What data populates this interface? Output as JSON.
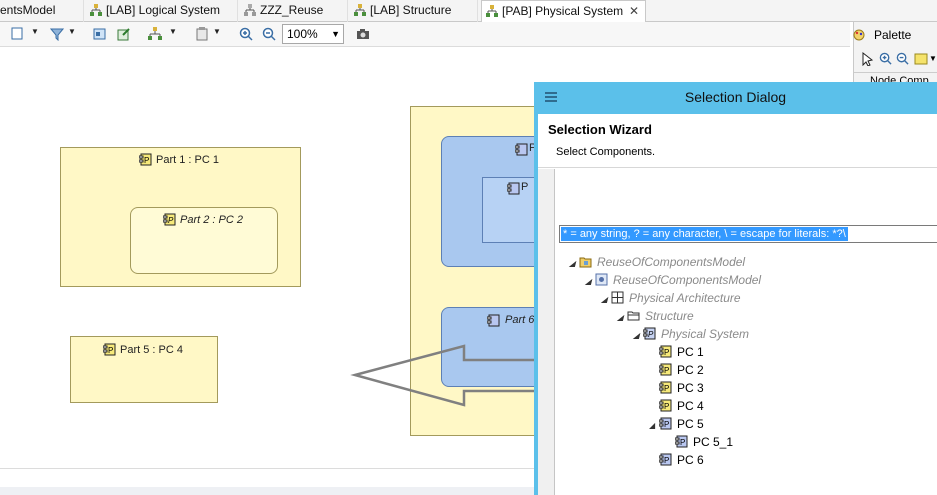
{
  "tabs": [
    {
      "label": "entsModel",
      "active": false
    },
    {
      "label": "[LAB] Logical System",
      "active": false
    },
    {
      "label": "ZZZ_Reuse",
      "active": false
    },
    {
      "label": "[LAB] Structure",
      "active": false
    },
    {
      "label": "[PAB] Physical System",
      "active": true
    }
  ],
  "tab_close_glyph": "✕",
  "toolbar": {
    "zoom": "100%"
  },
  "palette": {
    "title": "Palette",
    "partial_item": "Node Comp"
  },
  "diagram": {
    "part1_label": "Part 1 : PC 1",
    "part2_label": "Part 2 : PC 2",
    "part5_label": "Part 5 : PC 4",
    "part6_label": "Part 6",
    "cut_label_a": "P",
    "cut_label_b": "P"
  },
  "dialog": {
    "title": "Selection Dialog",
    "wizard_title": "Selection Wizard",
    "wizard_subtitle": "Select Components.",
    "filter_text": "* = any string, ? = any character, \\ = escape for literals: *?\\",
    "tree": [
      {
        "label": "ReuseOfComponentsModel",
        "icon": "folder-project-icon",
        "gray": true
      },
      {
        "label": "ReuseOfComponentsModel",
        "icon": "model-icon",
        "gray": true
      },
      {
        "label": "Physical Architecture",
        "icon": "architecture-icon",
        "gray": true
      },
      {
        "label": "Structure",
        "icon": "folder-icon",
        "gray": true
      },
      {
        "label": "Physical System",
        "icon": "physical-system-icon",
        "gray": true
      },
      {
        "label": "PC 1",
        "icon": "physical-component-icon",
        "gray": false
      },
      {
        "label": "PC 2",
        "icon": "physical-component-icon",
        "gray": false
      },
      {
        "label": "PC 3",
        "icon": "physical-component-icon",
        "gray": false
      },
      {
        "label": "PC 4",
        "icon": "physical-component-icon",
        "gray": false
      },
      {
        "label": "PC 5",
        "icon": "physical-node-icon",
        "gray": false
      },
      {
        "label": "PC 5_1",
        "icon": "physical-node-icon",
        "gray": false
      },
      {
        "label": "PC 6",
        "icon": "physical-node-icon",
        "gray": false
      }
    ]
  },
  "colors": {
    "dialog_title": "#5bc0ea",
    "part_fill": "#fff8c6",
    "node_fill": "#a9c8ef",
    "selection": "#3399ff"
  }
}
